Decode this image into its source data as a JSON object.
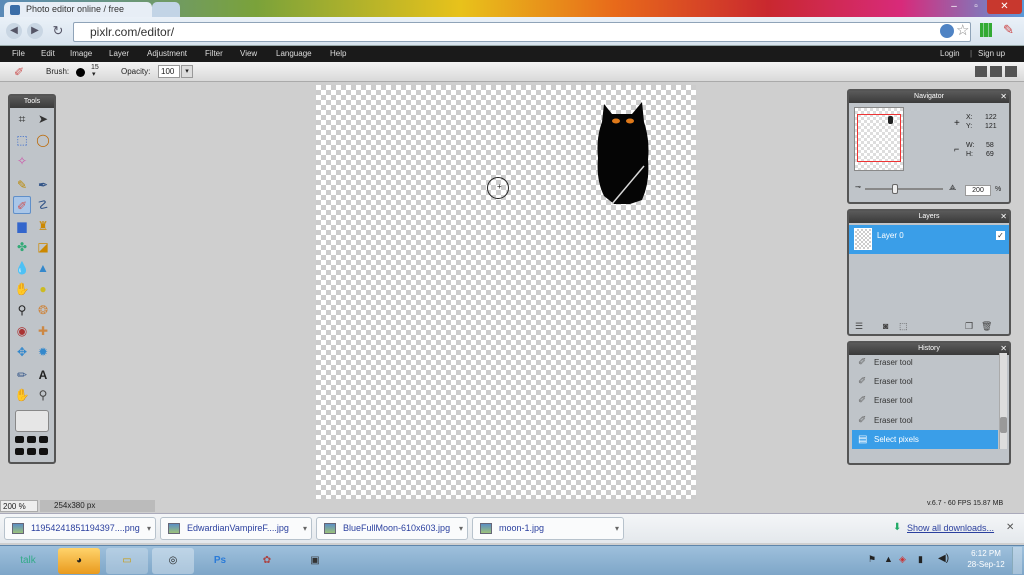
{
  "browser": {
    "tab_title": "Photo editor online / free",
    "url": "pixlr.com/editor/",
    "win_min": "–",
    "win_max": "▫",
    "win_close": "✕"
  },
  "menu": {
    "items": [
      "File",
      "Edit",
      "Image",
      "Layer",
      "Adjustment",
      "Filter",
      "View",
      "Language",
      "Help"
    ],
    "login": "Login",
    "signup": "Sign up",
    "separator": "|"
  },
  "options": {
    "brush_label": "Brush:",
    "brush_size": "15",
    "opacity_label": "Opacity:",
    "opacity_value": "100"
  },
  "tools_panel": {
    "title": "Tools"
  },
  "navigator": {
    "title": "Navigator",
    "x_label": "X:",
    "x_value": "122",
    "y_label": "Y:",
    "y_value": "121",
    "w_label": "W:",
    "w_value": "58",
    "h_label": "H:",
    "h_value": "69",
    "zoom_value": "200",
    "zoom_unit": "%",
    "zoom_level": 0.38
  },
  "layers": {
    "title": "Layers",
    "items": [
      {
        "label": "Layer 0"
      }
    ]
  },
  "history": {
    "title": "History",
    "items": [
      {
        "label": "Eraser tool"
      },
      {
        "label": "Eraser tool"
      },
      {
        "label": "Eraser tool"
      },
      {
        "label": "Eraser tool"
      },
      {
        "label": "Select pixels"
      }
    ]
  },
  "status": {
    "zoom": "200",
    "zoom_unit": "%",
    "size": "254x380 px",
    "version": "v.6.7 - 60 FPS 15.87 MB"
  },
  "downloads": {
    "items": [
      {
        "label": "11954241851194397....png"
      },
      {
        "label": "EdwardianVampireF....jpg"
      },
      {
        "label": "BlueFullMoon-610x603.jpg"
      },
      {
        "label": "moon-1.jpg"
      }
    ],
    "show_all": "Show all downloads...",
    "close": "✕"
  },
  "taskbar": {
    "time": "6:12 PM",
    "date": "28-Sep-12",
    "talk_label": "talk",
    "ps_label": "Ps"
  },
  "colors": {
    "accent": "#3a9ee8",
    "menu_bg": "#1a1a1a",
    "panel_bg": "#bfc4c9",
    "canvas_checker": "#cccccc"
  }
}
